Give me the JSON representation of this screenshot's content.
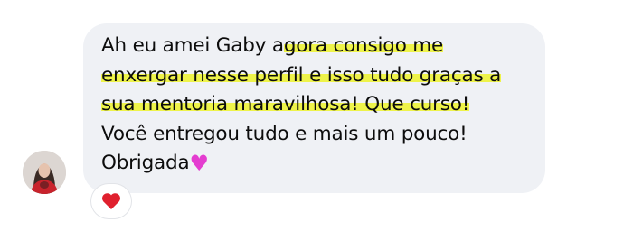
{
  "message": {
    "lines": [
      {
        "plain": "Ah eu amei Gaby a",
        "highlighted": "gora consigo me"
      },
      {
        "plain": "",
        "highlighted": "enxergar nesse perfil e isso tudo graças a"
      },
      {
        "plain": "",
        "highlighted": "sua mentoria maravilhosa! Que curso!"
      },
      {
        "plain": "Você entregou tudo e mais um pouco!",
        "highlighted": ""
      },
      {
        "plain": "Obrigada",
        "highlighted": ""
      }
    ],
    "emoji": "pink-heart-icon"
  },
  "reaction": {
    "emoji": "red-heart-icon"
  },
  "colors": {
    "bubble": "#eff1f5",
    "highlight": "#eef34a",
    "pink_heart": "#e43dd0",
    "red_heart": "#e0202e"
  }
}
